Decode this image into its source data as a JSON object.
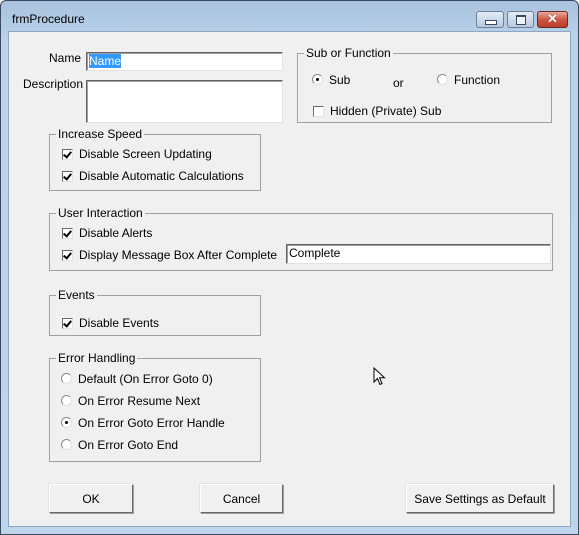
{
  "window": {
    "title": "frmProcedure",
    "controls": {
      "minimize": "minimize-icon",
      "maximize": "maximize-icon",
      "close": "close-icon",
      "close_glyph": "✕"
    }
  },
  "fields": {
    "name_label": "Name",
    "name_value": "Name",
    "description_label": "Description",
    "description_value": ""
  },
  "sub_or_function": {
    "title": "Sub or Function",
    "sub_label": "Sub",
    "sub_selected": true,
    "or_label": "or",
    "function_label": "Function",
    "function_selected": false,
    "hidden_label": "Hidden (Private) Sub",
    "hidden_checked": false
  },
  "increase_speed": {
    "title": "Increase Speed",
    "items": [
      {
        "label": "Disable Screen Updating",
        "checked": true
      },
      {
        "label": "Disable Automatic Calculations",
        "checked": true
      }
    ]
  },
  "user_interaction": {
    "title": "User Interaction",
    "items": [
      {
        "label": "Disable Alerts",
        "checked": true
      },
      {
        "label": "Display Message Box After Complete",
        "checked": true
      }
    ],
    "message_value": "Complete"
  },
  "events": {
    "title": "Events",
    "items": [
      {
        "label": "Disable Events",
        "checked": true
      }
    ]
  },
  "error_handling": {
    "title": "Error Handling",
    "options": [
      {
        "label": "Default (On Error Goto 0)",
        "selected": false
      },
      {
        "label": "On Error Resume Next",
        "selected": false
      },
      {
        "label": "On Error Goto Error Handle",
        "selected": true
      },
      {
        "label": "On Error Goto End",
        "selected": false
      }
    ]
  },
  "buttons": {
    "ok": "OK",
    "cancel": "Cancel",
    "save_default": "Save Settings as Default"
  }
}
